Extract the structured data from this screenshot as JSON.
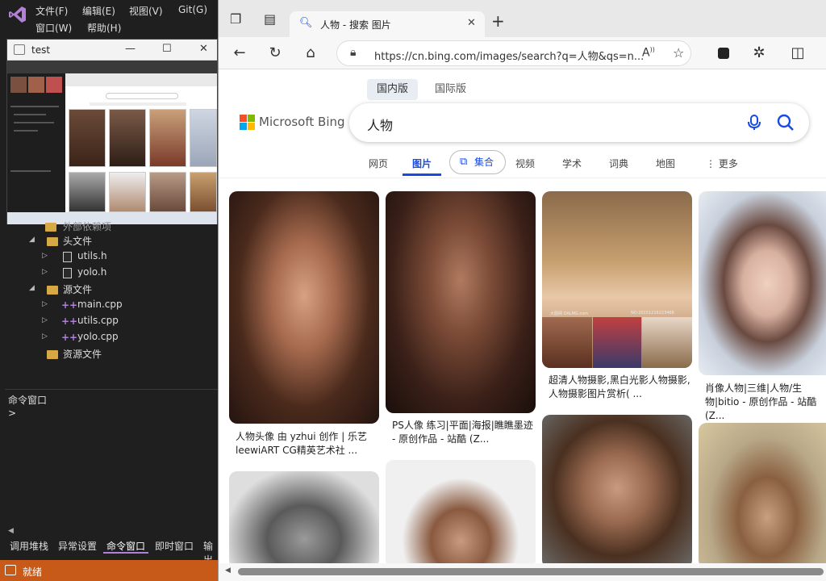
{
  "vs": {
    "menu": [
      "文件(F)",
      "编辑(E)",
      "视图(V)",
      "Git(G)",
      "窗口(W)",
      "帮助(H)"
    ],
    "test_window_title": "test",
    "tree": {
      "partial_row": "外部依赖项",
      "header_folder": "头文件",
      "header_files": [
        "utils.h",
        "yolo.h"
      ],
      "source_folder": "源文件",
      "source_files": [
        "main.cpp",
        "utils.cpp",
        "yolo.cpp"
      ],
      "resource_folder": "资源文件"
    },
    "command_panel_title": "命令窗口",
    "command_prompt": ">",
    "bottom_tabs": [
      "调用堆栈",
      "异常设置",
      "命令窗口",
      "即时窗口",
      "输出"
    ],
    "active_bottom_tab": "命令窗口",
    "status": "就绪",
    "accent_color": "#c75a19"
  },
  "browser": {
    "tab_title": "人物 - 搜索 图片",
    "address": "https://cn.bing.com/images/search?q=人物&qs=n...",
    "scopes": [
      "国内版",
      "国际版"
    ],
    "logo_text": "Microsoft Bing",
    "search_query": "人物",
    "nav": [
      "网页",
      "图片",
      "集合",
      "视频",
      "学术",
      "词典",
      "地图",
      "更多"
    ],
    "active_nav": "图片",
    "results": [
      {
        "caption": "人物头像 由 yzhui 创作 | 乐艺 leewiART CG精英艺术社 ..."
      },
      {
        "caption": "PS人像 练习|平面|海报|瞧瞧墨迹 - 原创作品 - 站酷 (Z..."
      },
      {
        "caption": "超清人物摄影,黑白光影人物摄影,人物摄影图片赏析( ..."
      },
      {
        "caption": "肖像人物|三维|人物/生物|bitio - 原创作品 - 站酷 (Z..."
      }
    ],
    "image_watermark": "大图网 DALMG.com",
    "image_watermark_id": "NO:20151216223466"
  }
}
